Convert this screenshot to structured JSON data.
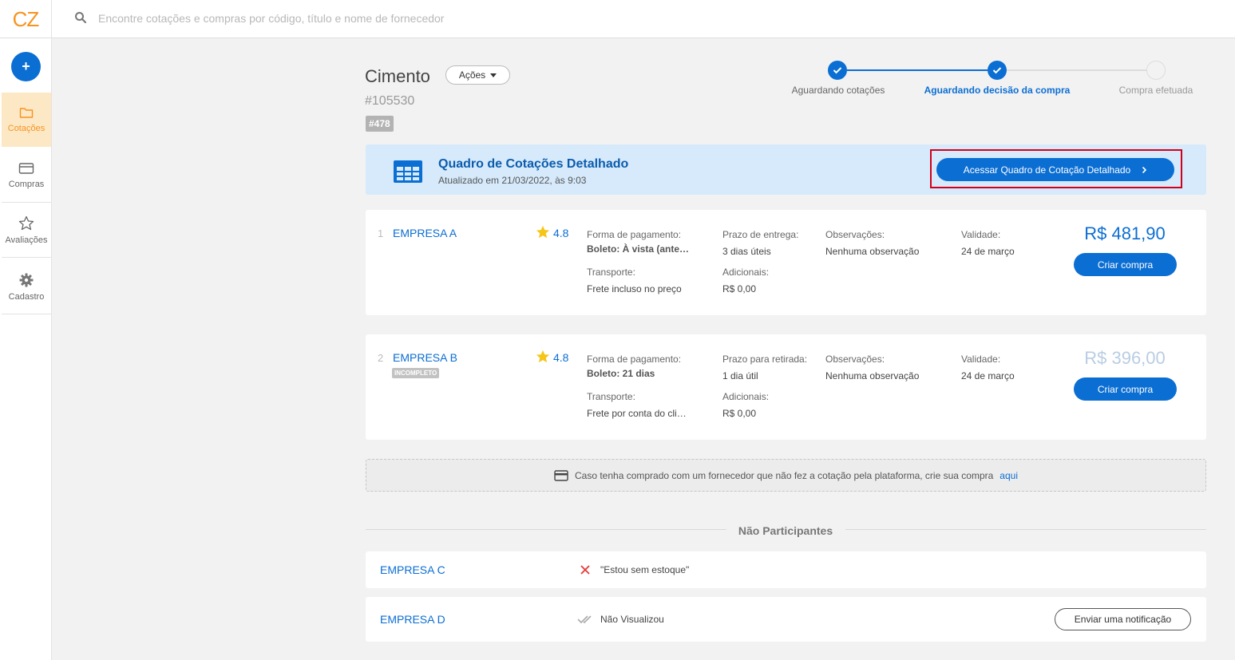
{
  "app": {
    "logo": "CZ"
  },
  "search": {
    "placeholder": "Encontre cotações e compras por código, título e nome de fornecedor"
  },
  "sidebar": {
    "add_label": "+",
    "items": [
      {
        "label": "Cotações",
        "icon": "folder-icon",
        "active": true
      },
      {
        "label": "Compras",
        "icon": "credit-card-icon",
        "active": false
      },
      {
        "label": "Avaliações",
        "icon": "star-icon",
        "active": false
      },
      {
        "label": "Cadastro",
        "icon": "gear-icon",
        "active": false
      }
    ]
  },
  "header": {
    "title": "Cimento",
    "actions_label": "Ações",
    "code": "#105530",
    "tag": "#478"
  },
  "stepper": {
    "steps": [
      {
        "label": "Aguardando cotações",
        "state": "done"
      },
      {
        "label": "Aguardando decisão da compra",
        "state": "current"
      },
      {
        "label": "Compra efetuada",
        "state": "todo"
      }
    ]
  },
  "banner": {
    "title": "Quadro de Cotações Detalhado",
    "subtitle": "Atualizado em 21/03/2022, às 9:03",
    "button_label": "Acessar Quadro de Cotação Detalhado"
  },
  "quotes": [
    {
      "index": "1",
      "company": "EMPRESA A",
      "badge": "",
      "rating": "4.8",
      "payment_label": "Forma de pagamento:",
      "payment_value": "Boleto: À vista (antecipado)",
      "delivery_label": "Prazo de entrega:",
      "delivery_value": "3 dias úteis",
      "notes_label": "Observações:",
      "notes_value": "Nenhuma observação",
      "validity_label": "Validade:",
      "validity_value": "24 de março",
      "transport_label": "Transporte:",
      "transport_value": "Frete incluso no preço",
      "extra_label": "Adicionais:",
      "extra_value": "R$ 0,00",
      "price": "R$ 481,90",
      "buy_label": "Criar compra"
    },
    {
      "index": "2",
      "company": "EMPRESA B",
      "badge": "INCOMPLETO",
      "rating": "4.8",
      "payment_label": "Forma de pagamento:",
      "payment_value": "Boleto: 21 dias",
      "delivery_label": "Prazo para retirada:",
      "delivery_value": "1 dia útil",
      "notes_label": "Observações:",
      "notes_value": "Nenhuma observação",
      "validity_label": "Validade:",
      "validity_value": "24 de março",
      "transport_label": "Transporte:",
      "transport_value": "Frete por conta do cliente",
      "extra_label": "Adicionais:",
      "extra_value": "R$ 0,00",
      "price": "R$ 396,00",
      "buy_label": "Criar compra"
    }
  ],
  "notice": {
    "text": "Caso tenha comprado com um fornecedor que não fez a cotação pela plataforma, crie sua compra",
    "link": "aqui"
  },
  "non_participants": {
    "title": "Não Participantes",
    "rows": [
      {
        "company": "EMPRESA C",
        "status": "\"Estou sem estoque\"",
        "icon": "close-icon"
      },
      {
        "company": "EMPRESA D",
        "status": "Não Visualizou",
        "icon": "double-check-icon",
        "button": "Enviar uma notificação"
      }
    ]
  },
  "colors": {
    "primary": "#0b6ed3",
    "brand_orange": "#f7931e",
    "banner_bg": "#d6eafc",
    "highlight": "#d0021b",
    "decline_red": "#e53935"
  }
}
